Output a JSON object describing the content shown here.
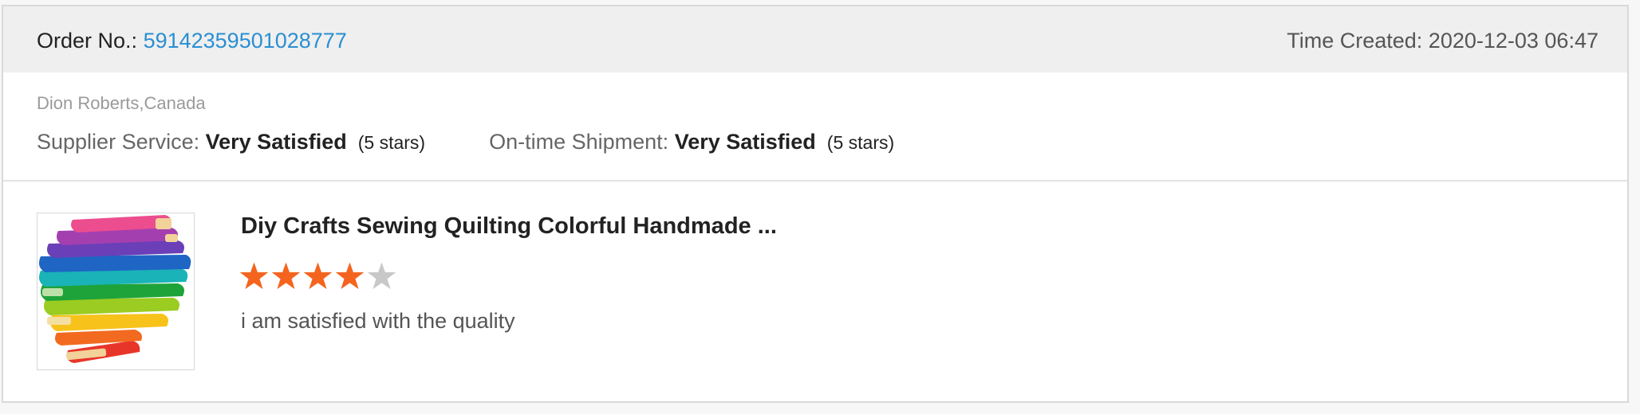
{
  "order": {
    "label": "Order No.:",
    "number": "59142359501028777",
    "time_created": "Time Created: 2020-12-03 06:47"
  },
  "customer": {
    "name_location": "Dion Roberts,Canada"
  },
  "service_ratings": [
    {
      "label": "Supplier Service:",
      "value": "Very Satisfied",
      "stars_text": "(5 stars)"
    },
    {
      "label": "On-time Shipment:",
      "value": "Very Satisfied",
      "stars_text": "(5 stars)"
    }
  ],
  "product": {
    "title": "Diy Crafts Sewing Quilting Colorful Handmade ...",
    "rating": 4,
    "rating_max": 5,
    "review": "i am satisfied with the quality",
    "image_icon": "rainbow-fabric-stack-image"
  },
  "colors": {
    "accent_link": "#2a8fd2",
    "star_filled": "#f5641e",
    "star_empty": "#c8c8c8",
    "header_bg": "#efefef"
  }
}
